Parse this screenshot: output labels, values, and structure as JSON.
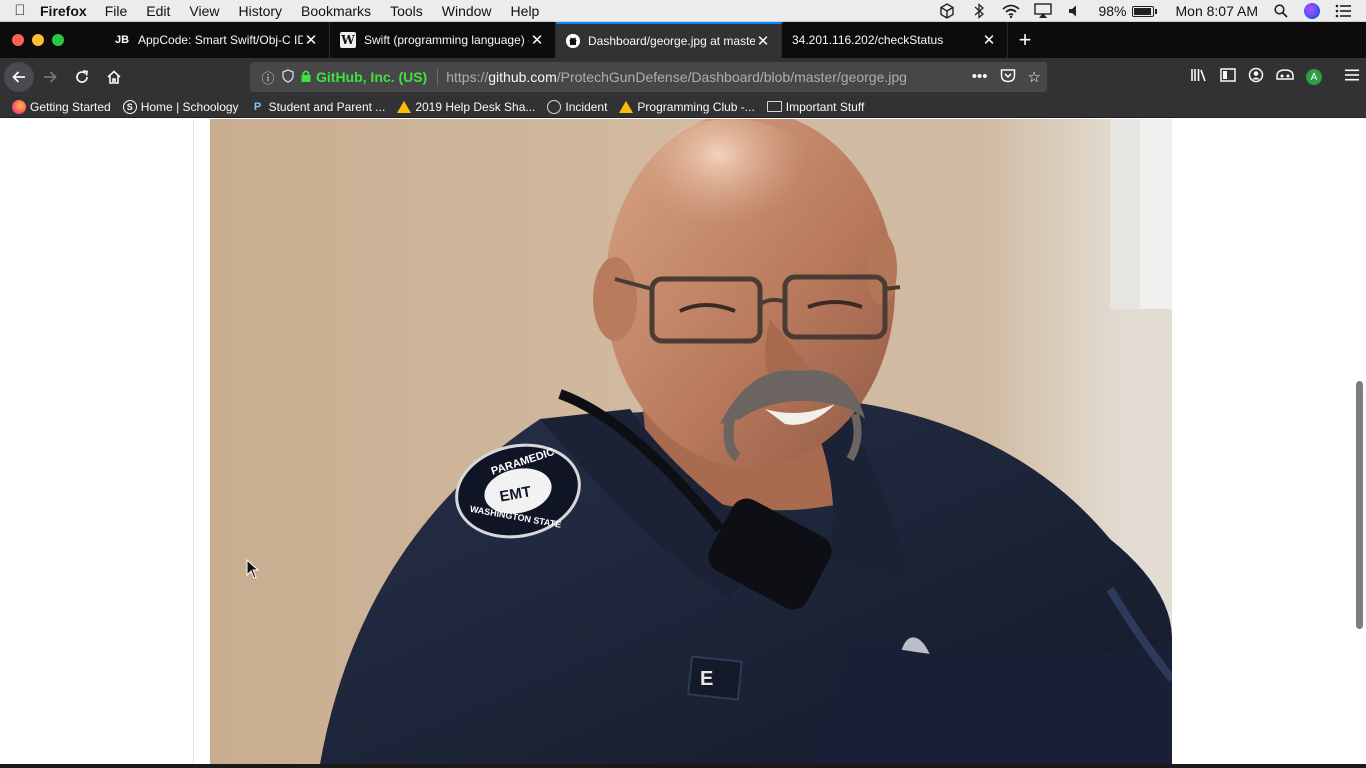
{
  "menubar": {
    "app_name": "Firefox",
    "menus": [
      "File",
      "Edit",
      "View",
      "History",
      "Bookmarks",
      "Tools",
      "Window",
      "Help"
    ],
    "battery": "98%",
    "clock": "Mon 8:07 AM"
  },
  "tabs": [
    {
      "favicon": "JB",
      "title": "AppCode: Smart Swift/Obj-C ID",
      "active": false
    },
    {
      "favicon": "W",
      "title": "Swift (programming language) -",
      "active": false
    },
    {
      "favicon": "github-icon",
      "title": "Dashboard/george.jpg at maste",
      "active": true
    },
    {
      "favicon": "",
      "title": "34.201.116.202/checkStatus",
      "active": false
    }
  ],
  "urlbar": {
    "identity": "GitHub, Inc. (US)",
    "url_prefix": "https://",
    "url_host": "github.com",
    "url_path": "/ProtechGunDefense/Dashboard/blob/master/george.jpg"
  },
  "toolbar": {
    "account_initial": "A"
  },
  "bookmarks": [
    {
      "icon": "firefox-icon",
      "label": "Getting Started"
    },
    {
      "icon": "schoology-icon",
      "label": "Home | Schoology"
    },
    {
      "icon": "p-icon",
      "label": "Student and Parent ..."
    },
    {
      "icon": "drive-icon",
      "label": "2019 Help Desk Sha..."
    },
    {
      "icon": "globe-icon",
      "label": "Incident"
    },
    {
      "icon": "drive-icon",
      "label": "Programming Club -..."
    },
    {
      "icon": "folder-icon",
      "label": "Important Stuff"
    }
  ],
  "photo": {
    "patch_top": "PARAMEDIC",
    "patch_center": "EMT",
    "patch_bottom": "WASHINGTON STATE",
    "name_tag": "E"
  },
  "colors": {
    "tab_accent": "#0a84ff",
    "secure_identity": "#3fe13f",
    "uniform": "#1c2333",
    "background_wall": "#cbb196"
  }
}
